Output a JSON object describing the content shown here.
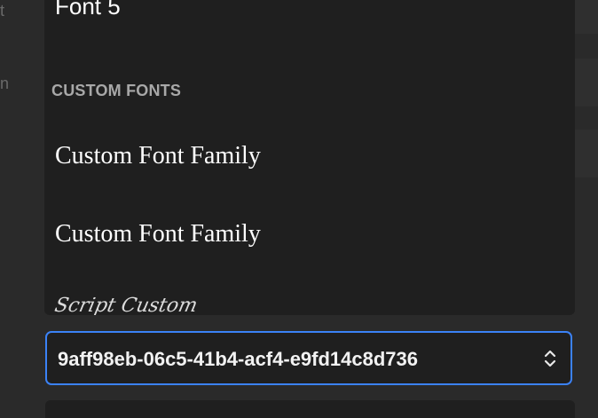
{
  "background": {
    "letter_1": "t",
    "letter_2": "n"
  },
  "dropdown": {
    "options_top": [
      {
        "label": "Font 5"
      }
    ],
    "group_label": "CUSTOM FONTS",
    "custom_options": [
      {
        "label": "Custom Font Family"
      },
      {
        "label": "Custom Font Family"
      },
      {
        "label": "Script Custom"
      }
    ]
  },
  "select": {
    "value": "9aff98eb-06c5-41b4-acf4-e9fd14c8d736",
    "icon": "chevron-up-down-icon"
  },
  "colors": {
    "accent": "#3b82f6",
    "dropdown_bg": "#1f1f1f",
    "page_bg": "#2a2a2a"
  }
}
